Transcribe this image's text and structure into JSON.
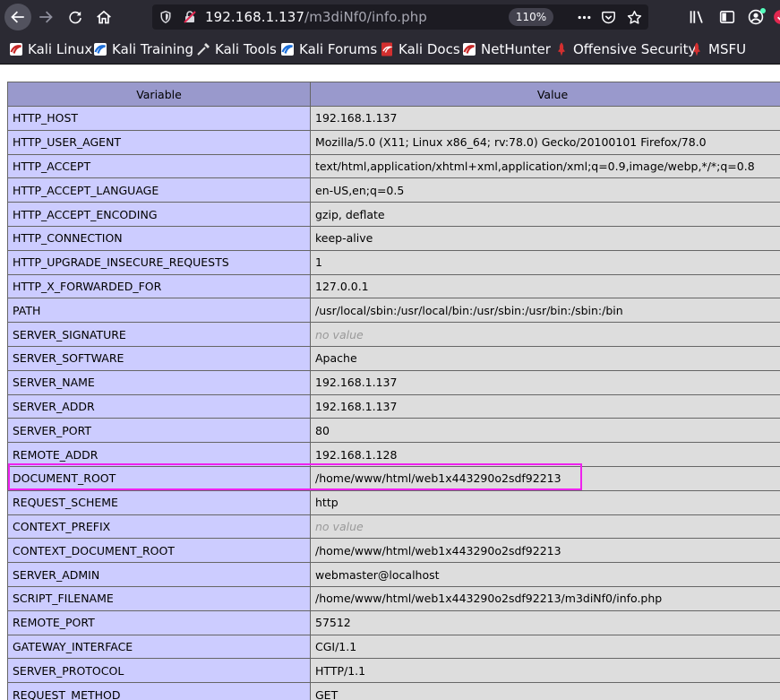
{
  "browser": {
    "url_host": "192.168.1.137",
    "url_path": "/m3diNf0/info.php",
    "zoom": "110%",
    "icons": [
      "back-arrow-icon",
      "forward-arrow-icon",
      "reload-icon",
      "home-icon",
      "shield-icon",
      "insecure-lock-icon",
      "more-dots-icon",
      "pocket-icon",
      "star-icon",
      "library-icon",
      "sidebar-icon",
      "account-icon",
      "extension-icon"
    ]
  },
  "bookmarks": [
    {
      "label": "Kali Linux",
      "icon": "kali-icon"
    },
    {
      "label": "Kali Training",
      "icon": "kali-training-icon"
    },
    {
      "label": "Kali Tools",
      "icon": "kali-tools-icon"
    },
    {
      "label": "Kali Forums",
      "icon": "kali-forums-icon"
    },
    {
      "label": "Kali Docs",
      "icon": "kali-docs-icon"
    },
    {
      "label": "NetHunter",
      "icon": "nethunter-icon"
    },
    {
      "label": "Offensive Security",
      "icon": "offsec-icon"
    },
    {
      "label": "MSFU",
      "icon": "msfu-icon"
    }
  ],
  "table": {
    "headers": {
      "variable": "Variable",
      "value": "Value"
    },
    "rows": [
      {
        "name": "HTTP_HOST",
        "value": "192.168.1.137"
      },
      {
        "name": "HTTP_USER_AGENT",
        "value": "Mozilla/5.0 (X11; Linux x86_64; rv:78.0) Gecko/20100101 Firefox/78.0"
      },
      {
        "name": "HTTP_ACCEPT",
        "value": "text/html,application/xhtml+xml,application/xml;q=0.9,image/webp,*/*;q=0.8"
      },
      {
        "name": "HTTP_ACCEPT_LANGUAGE",
        "value": "en-US,en;q=0.5"
      },
      {
        "name": "HTTP_ACCEPT_ENCODING",
        "value": "gzip, deflate"
      },
      {
        "name": "HTTP_CONNECTION",
        "value": "keep-alive"
      },
      {
        "name": "HTTP_UPGRADE_INSECURE_REQUESTS",
        "value": "1"
      },
      {
        "name": "HTTP_X_FORWARDED_FOR",
        "value": "127.0.0.1"
      },
      {
        "name": "PATH",
        "value": "/usr/local/sbin:/usr/local/bin:/usr/sbin:/usr/bin:/sbin:/bin"
      },
      {
        "name": "SERVER_SIGNATURE",
        "value": "no value",
        "empty": true
      },
      {
        "name": "SERVER_SOFTWARE",
        "value": "Apache"
      },
      {
        "name": "SERVER_NAME",
        "value": "192.168.1.137"
      },
      {
        "name": "SERVER_ADDR",
        "value": "192.168.1.137"
      },
      {
        "name": "SERVER_PORT",
        "value": "80"
      },
      {
        "name": "REMOTE_ADDR",
        "value": "192.168.1.128"
      },
      {
        "name": "DOCUMENT_ROOT",
        "value": "/home/www/html/web1x443290o2sdf92213",
        "highlighted": true
      },
      {
        "name": "REQUEST_SCHEME",
        "value": "http"
      },
      {
        "name": "CONTEXT_PREFIX",
        "value": "no value",
        "empty": true
      },
      {
        "name": "CONTEXT_DOCUMENT_ROOT",
        "value": "/home/www/html/web1x443290o2sdf92213"
      },
      {
        "name": "SERVER_ADMIN",
        "value": "webmaster@localhost"
      },
      {
        "name": "SCRIPT_FILENAME",
        "value": "/home/www/html/web1x443290o2sdf92213/m3diNf0/info.php"
      },
      {
        "name": "REMOTE_PORT",
        "value": "57512"
      },
      {
        "name": "GATEWAY_INTERFACE",
        "value": "CGI/1.1"
      },
      {
        "name": "SERVER_PROTOCOL",
        "value": "HTTP/1.1"
      },
      {
        "name": "REQUEST_METHOD",
        "value": "GET"
      }
    ]
  },
  "colors": {
    "header_bg": "#9999cc",
    "name_cell_bg": "#ccccff",
    "value_cell_bg": "#dddddd",
    "highlight": "#ee22ee",
    "chrome_bg": "#2b2a33"
  }
}
